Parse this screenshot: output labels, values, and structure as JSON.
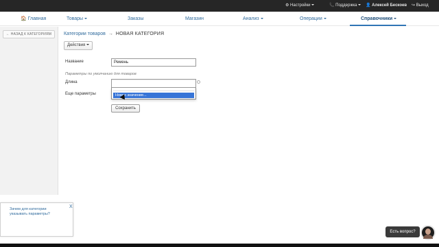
{
  "topbar": {
    "settings": "⚙ Настройки",
    "support": "📞 Поддержка",
    "user": "👤 Алексей Бескоев",
    "exit": "↪ Выход"
  },
  "nav": {
    "home": "🏠 Главная",
    "goods": "Товары",
    "orders": "Заказы",
    "store": "Магазин",
    "analysis": "Анализ",
    "operations": "Операции",
    "references": "Справочники"
  },
  "sidebar": {
    "back_label": "← НАЗАД К КАТЕГОРИЯМ"
  },
  "breadcrumb": {
    "link": "Категории товаров",
    "arrow": "→",
    "current": "НОВАЯ КАТЕГОРИЯ"
  },
  "actions": {
    "label": "Действия"
  },
  "form": {
    "name_label": "Название",
    "name_value": "Ремень",
    "hint": "Параметры по умолчанию для товаров",
    "length_label": "Длина",
    "more_label": "Еще параметры",
    "dropdown_option": "Новое значение...",
    "save_label": "Сохранить"
  },
  "popup": {
    "line1": "Зачем для категории",
    "line2": "указывать параметры?",
    "close": "X"
  },
  "chat": {
    "label": "Есть вопрос?"
  },
  "colors": {
    "topbar": "#262626",
    "link": "#2f6a9c",
    "accent": "#2f74b5",
    "selection": "#3875d7"
  }
}
